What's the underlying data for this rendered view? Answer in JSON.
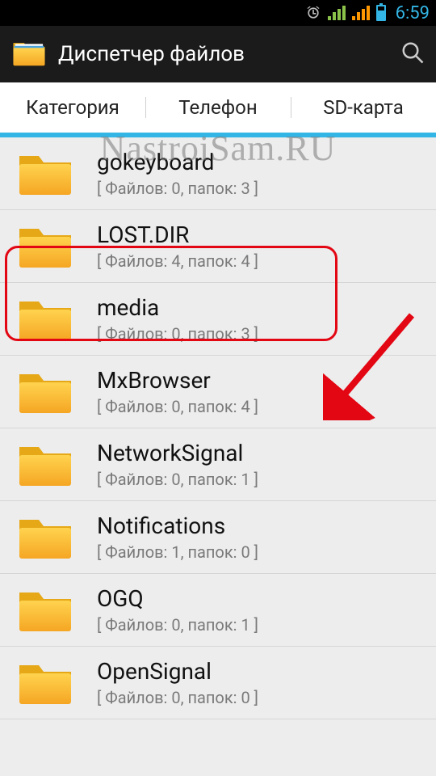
{
  "status": {
    "time": "6:59"
  },
  "header": {
    "title": "Диспетчер файлов"
  },
  "tabs": {
    "items": [
      {
        "label": "Категория"
      },
      {
        "label": "Телефон"
      },
      {
        "label": "SD-карта"
      }
    ],
    "active_index": 1
  },
  "list": {
    "items": [
      {
        "name": "gokeyboard",
        "count": "[ Файлов: 0, папок: 3 ]",
        "highlight": false
      },
      {
        "name": "LOST.DIR",
        "count": "[ Файлов: 4, папок: 4 ]",
        "highlight": true
      },
      {
        "name": "media",
        "count": "[ Файлов: 0, папок: 3 ]",
        "highlight": false
      },
      {
        "name": "MxBrowser",
        "count": "[ Файлов: 0, папок: 4 ]",
        "highlight": false
      },
      {
        "name": "NetworkSignal",
        "count": "[ Файлов: 0, папок: 1 ]",
        "highlight": false
      },
      {
        "name": "Notifications",
        "count": "[ Файлов: 1, папок: 0 ]",
        "highlight": false
      },
      {
        "name": "OGQ",
        "count": "[ Файлов: 0, папок: 1 ]",
        "highlight": false
      },
      {
        "name": "OpenSignal",
        "count": "[ Файлов: 0, папок: 0 ]",
        "highlight": false
      }
    ]
  },
  "watermark": "NastroiSam.RU"
}
